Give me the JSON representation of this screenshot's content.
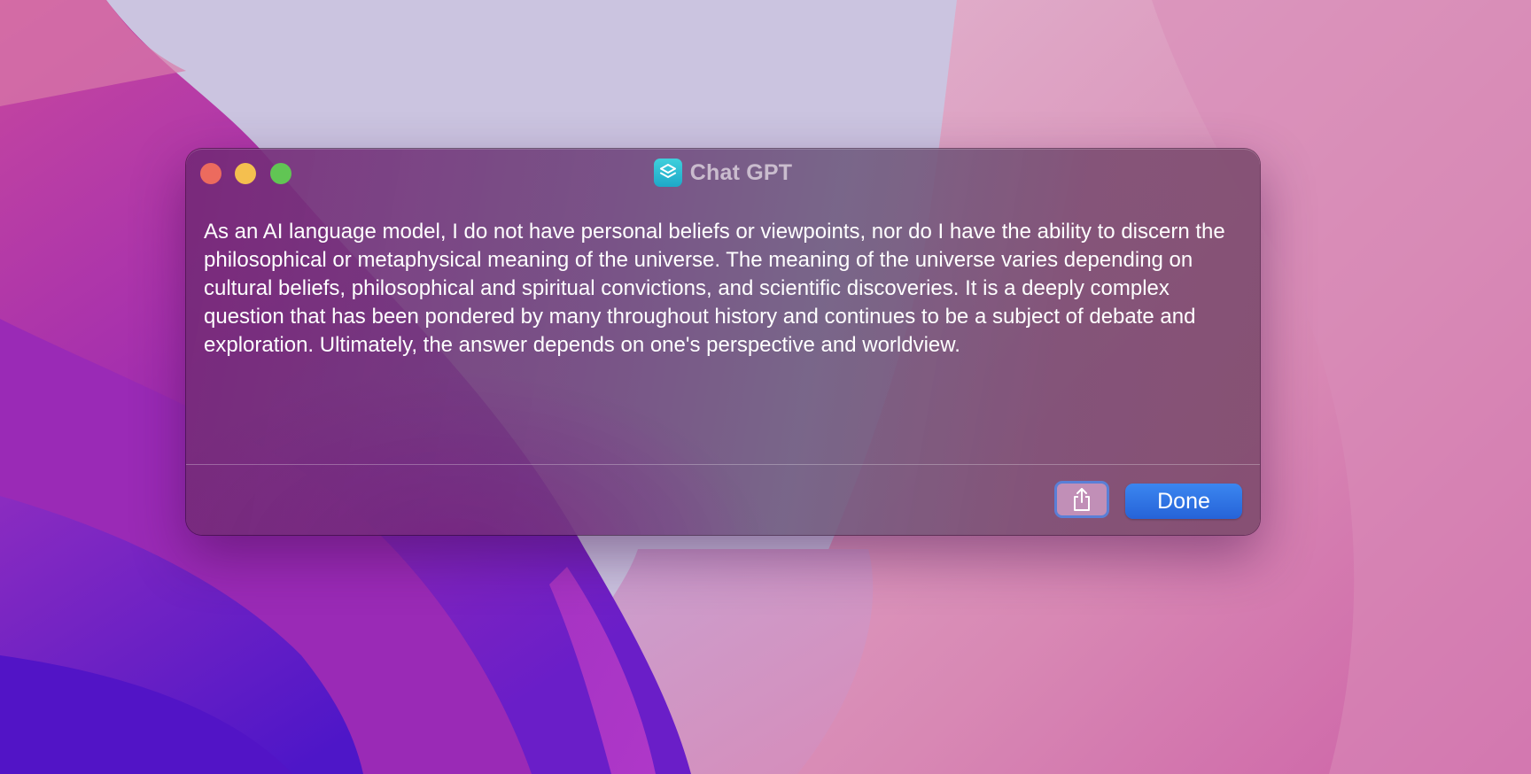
{
  "window": {
    "title": "Chat GPT",
    "app_icon": "shortcuts-icon"
  },
  "dialog": {
    "message": "As an AI language model, I do not have personal beliefs or viewpoints, nor do I have the ability to discern the philosophical or metaphysical meaning of the universe. The meaning of the universe varies depending on cultural beliefs, philosophical and spiritual convictions, and scientific discoveries. It is a deeply complex question that has been pondered by many throughout history and continues to be a subject of debate and exploration. Ultimately, the answer depends on one's perspective and worldview."
  },
  "buttons": {
    "share_icon": "share-icon",
    "done_label": "Done"
  },
  "colors": {
    "close": "#ec6b5e",
    "minimize": "#f4bf4f",
    "zoom": "#61c554",
    "accent": "#2f72e4",
    "focus_ring": "#5a7fd6"
  }
}
